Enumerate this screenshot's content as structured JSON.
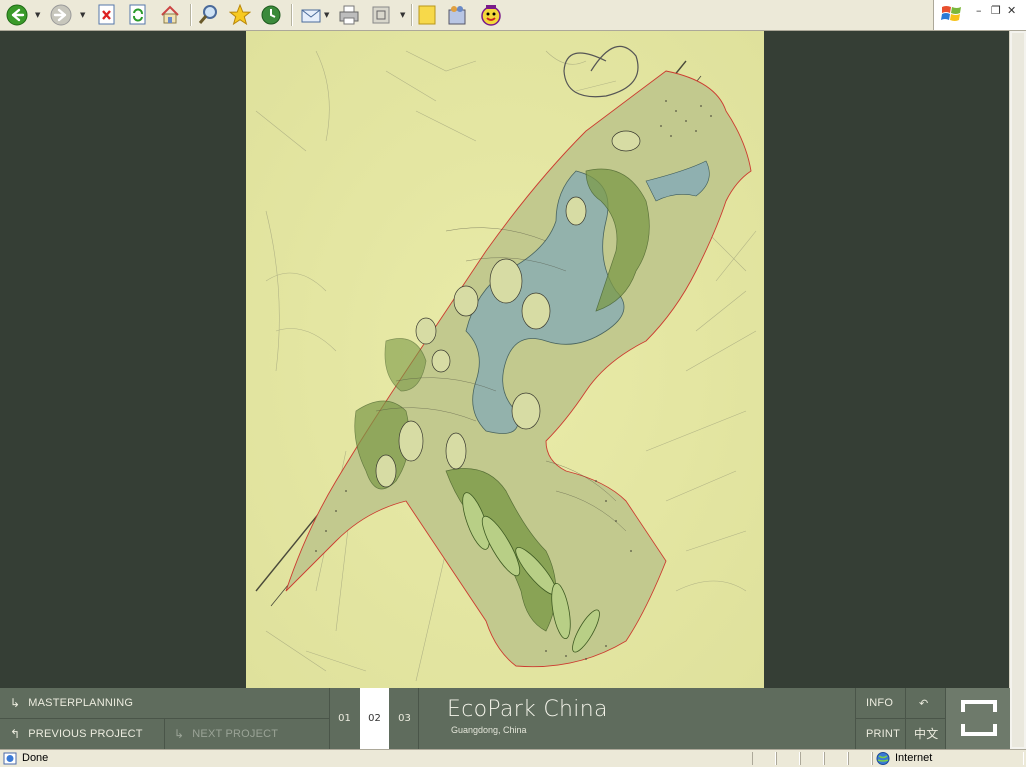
{
  "toolbar": {
    "buttons": [
      "back-icon",
      "forward-icon",
      "stop-icon",
      "refresh-icon",
      "home-icon",
      "search-icon",
      "favorites-icon",
      "history-icon",
      "mail-icon",
      "print-icon",
      "media-icon",
      "notes-icon",
      "messenger-icon",
      "yahoo-messenger-icon"
    ]
  },
  "window": {
    "minimize": "–",
    "restore": "❐",
    "close": "✕"
  },
  "project": {
    "title": "EcoPark China",
    "location": "Guangdong, China"
  },
  "nav": {
    "category": "MASTERPLANNING",
    "previous": "PREVIOUS PROJECT",
    "next": "NEXT PROJECT",
    "pages": [
      "01",
      "02",
      "03"
    ],
    "active_page": "02",
    "info": "INFO",
    "print": "PRINT",
    "language": "中文",
    "back_arrow": "↶"
  },
  "status": {
    "text": "Done",
    "zone": "Internet"
  },
  "colors": {
    "background": "#353d35",
    "navbar": "#5f6c5d",
    "sketch_paper": "#e6e8a4",
    "water": "#8fb0b0",
    "vegetation": "#6b8c3c",
    "boundary": "#d33b30"
  }
}
